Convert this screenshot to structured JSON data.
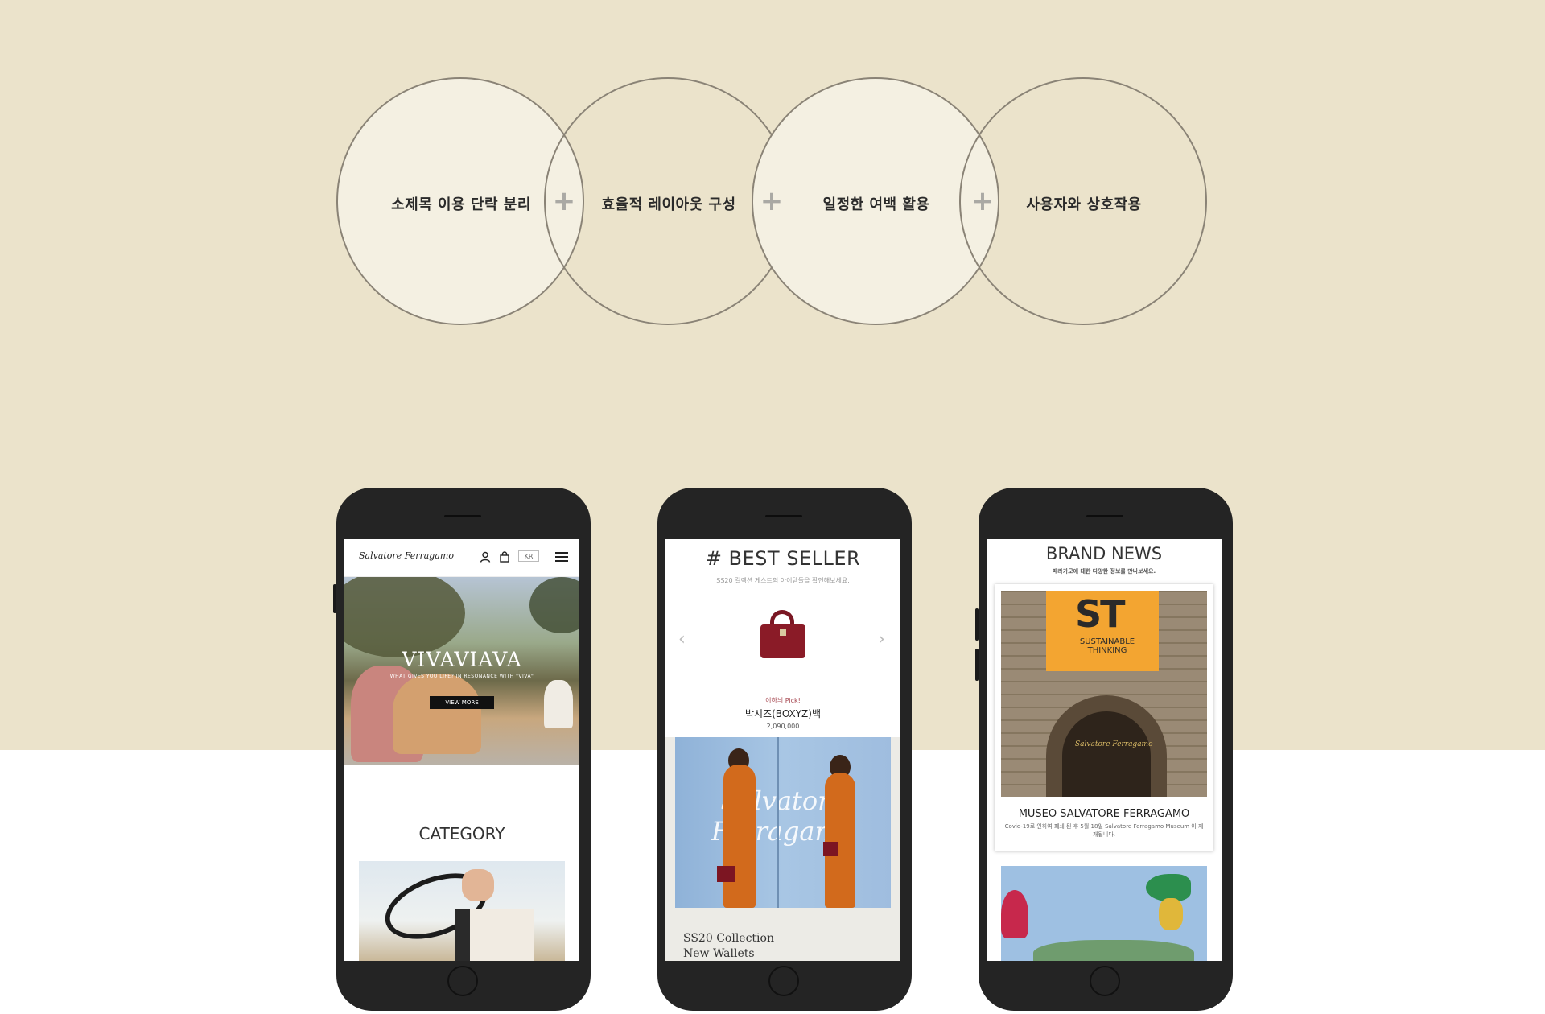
{
  "principles": [
    {
      "label": "소제목 이용 단락 분리"
    },
    {
      "label": "효율적 레이아웃 구성"
    },
    {
      "label": "일정한 여백 활용"
    },
    {
      "label": "사용자와 상호작용"
    }
  ],
  "plus_symbol": "+",
  "colors": {
    "background_top": "#ebe3cb",
    "circle_light": "#f4f0e2",
    "circle_border": "#8a8376",
    "phone_body": "#242424"
  },
  "phone_home": {
    "logo": "Salvatore Ferragamo",
    "icons": [
      "user-icon",
      "shopping-bag-icon"
    ],
    "lang": "KR",
    "hero_title": "VIVAVIAVA",
    "hero_subtitle": "WHAT GIVES YOU LIFE? IN RESONANCE WITH \"VIVA\"",
    "hero_button": "VIEW MORE",
    "category_title": "CATEGORY"
  },
  "phone_bestseller": {
    "title": "# BEST SELLER",
    "subtitle": "SS20 컬렉션 게스트의 아이템들을 확인해보세요.",
    "prev": "‹",
    "next": "›",
    "pick_label": "이하늬 Pick!",
    "product_name": "박시즈(BOXYZ)백",
    "price": "2,090,000",
    "caption_line1": "SS20 Collection",
    "caption_line2": "New Wallets"
  },
  "phone_news": {
    "title": "BRAND NEWS",
    "subtitle": "페라가모에 대한 다양한 정보를 만나보세요.",
    "banner_big": "ST",
    "banner_text": "SUSTAINABLE THINKING",
    "sign": "Salvatore Ferragamo",
    "card_title": "MUSEO SALVATORE FERRAGAMO",
    "card_desc": "Covid-19로 인하여 폐쇄 된 후 5월 18일 Salvatore Ferragamo Museum 이 재개됩니다."
  }
}
